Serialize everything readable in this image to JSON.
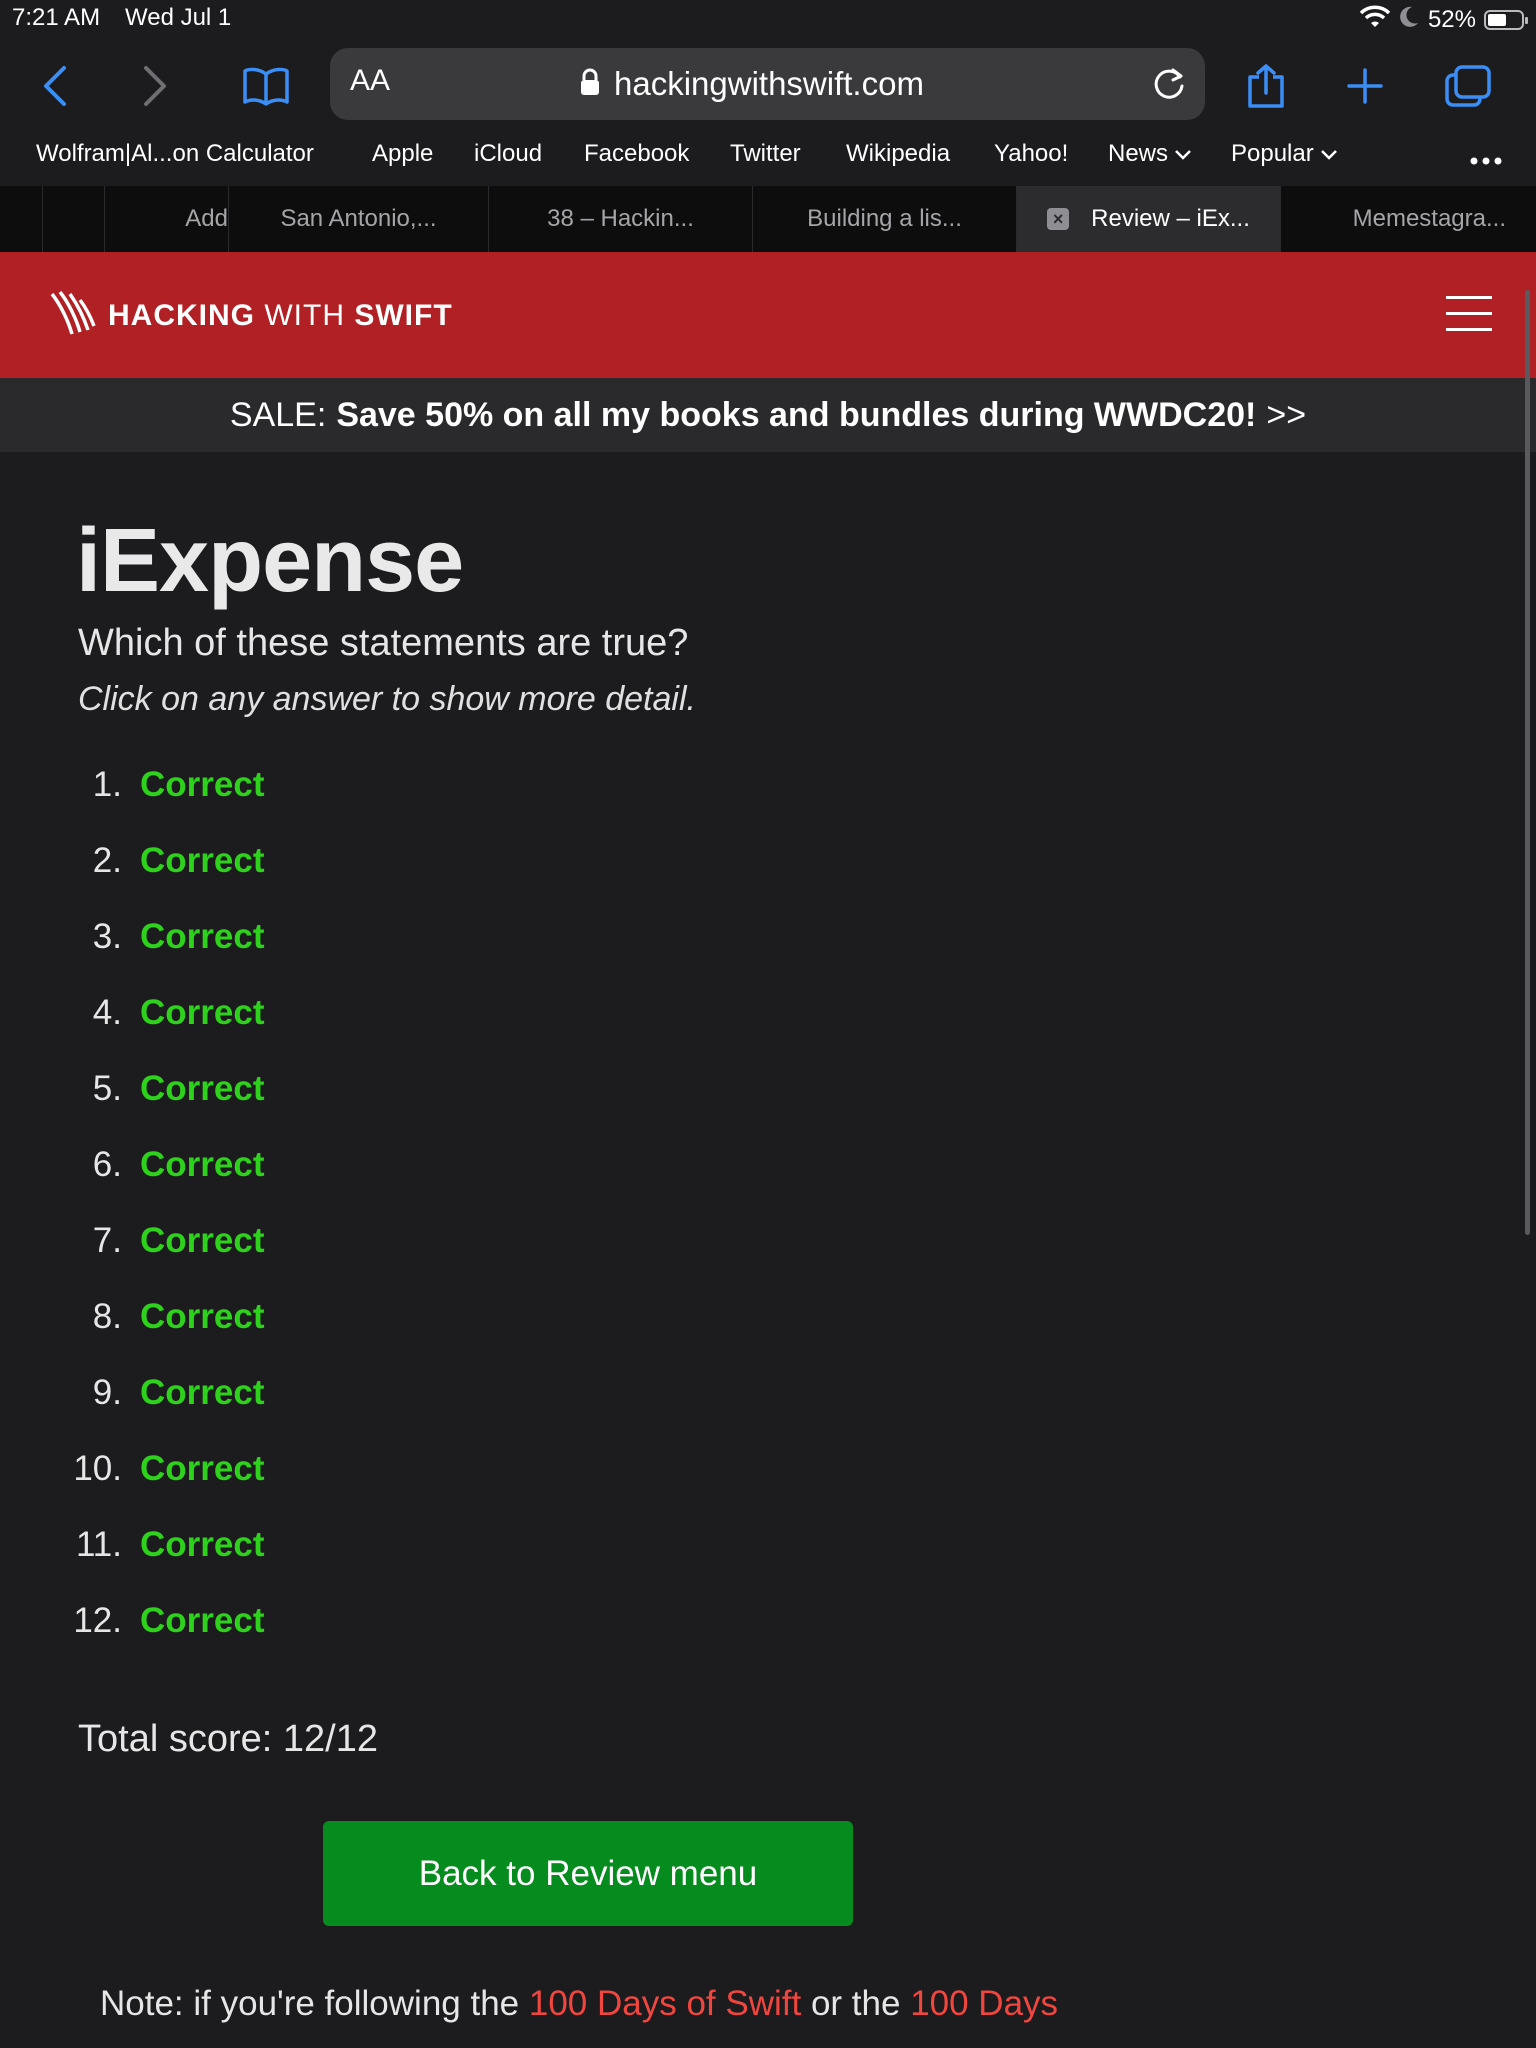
{
  "status_bar": {
    "time": "7:21 AM",
    "date": "Wed Jul 1",
    "battery": "52%",
    "icons": [
      "wifi-icon",
      "moon-icon",
      "battery-icon"
    ]
  },
  "toolbar": {
    "text_size_label": "AA",
    "url": "hackingwithswift.com",
    "accent_color": "#3a8ef6",
    "icons": [
      "back-icon",
      "forward-icon",
      "bookmarks-icon",
      "lock-icon",
      "reload-icon",
      "share-icon",
      "new-tab-icon",
      "tabs-icon"
    ]
  },
  "bookmarks": [
    "Wolfram|Al...on Calculator",
    "Apple",
    "iCloud",
    "Facebook",
    "Twitter",
    "Wikipedia",
    "Yahoo!",
    "News",
    "Popular"
  ],
  "tabs": [
    {
      "label": ""
    },
    {
      "label": ""
    },
    {
      "label": "Add"
    },
    {
      "label": "San Antonio,..."
    },
    {
      "label": "38 – Hackin..."
    },
    {
      "label": "Building a lis..."
    },
    {
      "label": "Review – iEx...",
      "active": true
    },
    {
      "label": "Memestagra..."
    }
  ],
  "site": {
    "logo_text_bold_1": "HACKING",
    "logo_text_mid": "WITH",
    "logo_text_bold_2": "SWIFT",
    "header_color": "#b12024"
  },
  "sale": {
    "prefix": "SALE:",
    "message": "Save 50% on all my books and bundles during WWDC20!",
    "suffix": ">>"
  },
  "page": {
    "title": "iExpense",
    "question": "Which of these statements are true?",
    "instruction": "Click on any answer to show more detail.",
    "results": [
      {
        "number": "1.",
        "result": "Correct"
      },
      {
        "number": "2.",
        "result": "Correct"
      },
      {
        "number": "3.",
        "result": "Correct"
      },
      {
        "number": "4.",
        "result": "Correct"
      },
      {
        "number": "5.",
        "result": "Correct"
      },
      {
        "number": "6.",
        "result": "Correct"
      },
      {
        "number": "7.",
        "result": "Correct"
      },
      {
        "number": "8.",
        "result": "Correct"
      },
      {
        "number": "9.",
        "result": "Correct"
      },
      {
        "number": "10.",
        "result": "Correct"
      },
      {
        "number": "11.",
        "result": "Correct"
      },
      {
        "number": "12.",
        "result": "Correct"
      }
    ],
    "total_score": "Total score: 12/12",
    "back_button": "Back to Review menu",
    "note_prefix": "Note: if you're following the",
    "note_link_1": "100 Days of Swift",
    "note_middle": "or the",
    "note_link_2": "100 Days",
    "correct_color": "#2ed11b",
    "button_color": "#068b1e"
  }
}
